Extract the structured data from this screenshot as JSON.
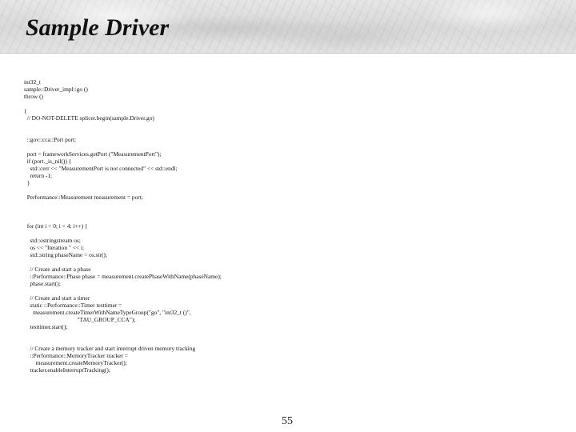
{
  "slide": {
    "title": "Sample Driver",
    "code_lines": [
      "int32_t",
      "sample::Driver_impl::go ()",
      "throw ()",
      "",
      "{",
      "  // DO-NOT-DELETE splicer.begin(sample.Driver.go)",
      "",
      "",
      "  ::gov::cca::Port port;",
      "",
      "  port = frameworkServices.getPort (\"MeasurementPort\");",
      "  if (port._is_nil()) {",
      "    std::cerr << \"MeasurementPort is not connected\" << std::endl;",
      "    return -1;",
      "  }",
      "",
      "  Performance::Measurement measurement = port;",
      "",
      "",
      "",
      "  for (int i = 0; i < 4; i++) {",
      "",
      "    std::ostringstream os;",
      "    os << \"Iteration \" << i;",
      "    std::string phaseName = os.str();",
      "",
      "    // Create and start a phase",
      "    ::Performance::Phase phase = measurement.createPhaseWithName(phaseName);",
      "    phase.start();",
      "",
      "    // Create and start a timer",
      "    static ::Performance::Timer testtimer =",
      "      measurement.createTimerWithNameTypeGroup(\"go\", \"int32_t ()\",",
      "                                    \"TAU_GROUP_CCA\");",
      "    testtimer.start();",
      "",
      "",
      "    // Create a memory tracker and start interrupt driven memory tracking",
      "    ::Performance::MemoryTracker tracker =",
      "        measurement.createMemoryTracker();",
      "    tracker.enableInterruptTracking();"
    ],
    "page_number": "55"
  }
}
